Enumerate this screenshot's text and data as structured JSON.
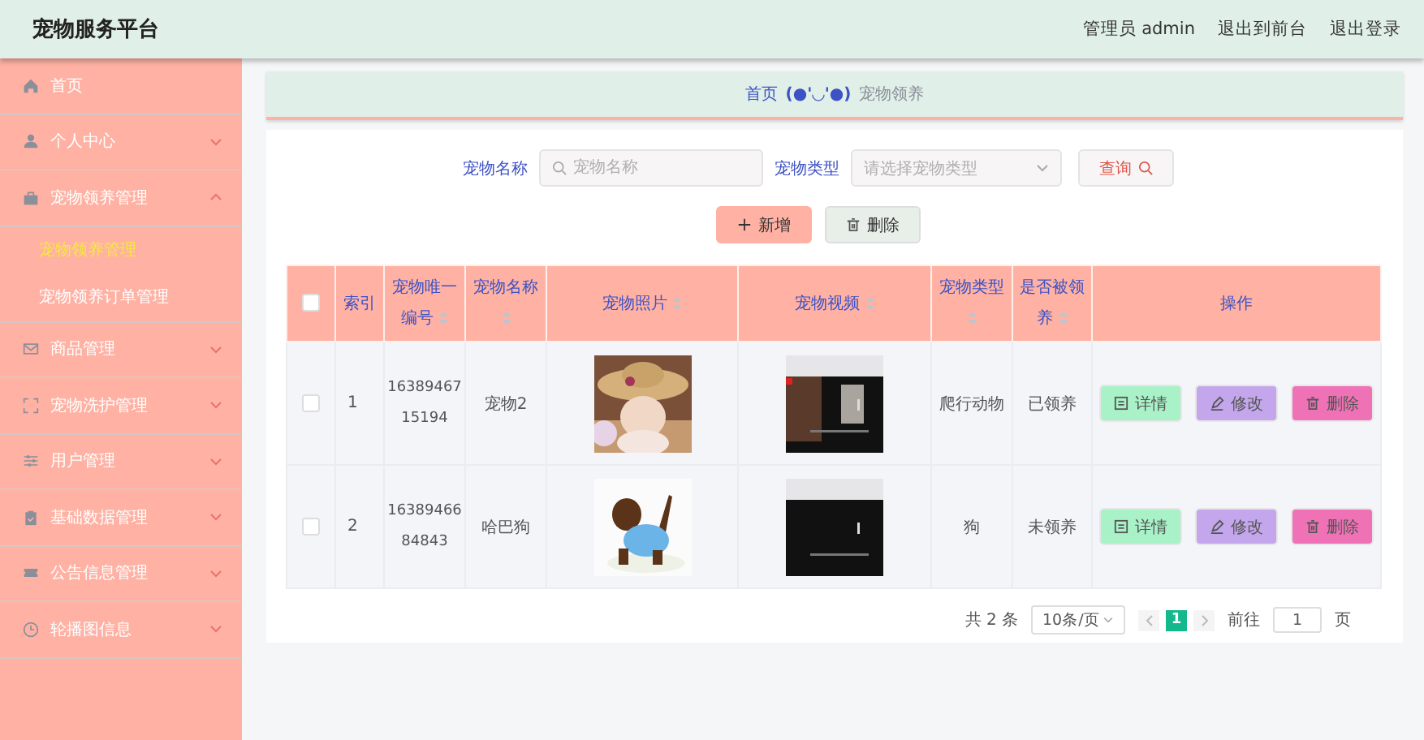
{
  "header": {
    "title": "宠物服务平台",
    "links": [
      "管理员 admin",
      "退出到前台",
      "退出登录"
    ]
  },
  "sidebar": {
    "items": [
      {
        "label": "首页"
      },
      {
        "label": "个人中心",
        "expanded": false
      },
      {
        "label": "宠物领养管理",
        "expanded": true,
        "children": [
          {
            "label": "宠物领养管理",
            "selected": true
          },
          {
            "label": "宠物领养订单管理",
            "selected": false
          }
        ]
      },
      {
        "label": "商品管理",
        "expanded": false
      },
      {
        "label": "宠物洗护管理",
        "expanded": false
      },
      {
        "label": "用户管理",
        "expanded": false
      },
      {
        "label": "基础数据管理",
        "expanded": false
      },
      {
        "label": "公告信息管理",
        "expanded": false
      },
      {
        "label": "轮播图信息",
        "expanded": false
      }
    ]
  },
  "breadcrumb": {
    "home": "首页",
    "separator": "(●'◡'●)",
    "current": "宠物领养"
  },
  "search": {
    "name_label": "宠物名称",
    "name_placeholder": "宠物名称",
    "type_label": "宠物类型",
    "type_placeholder": "请选择宠物类型",
    "button": "查询"
  },
  "toolbar": [
    {
      "kind": "add",
      "label": "新增"
    },
    {
      "kind": "delete",
      "label": "删除"
    }
  ],
  "table": {
    "all_checked": false,
    "columns": [
      {
        "label": "索引",
        "sortable": false
      },
      {
        "label": "宠物唯一编号",
        "sortable": true
      },
      {
        "label": "宠物名称",
        "sortable": true
      },
      {
        "label": "宠物照片",
        "sortable": true
      },
      {
        "label": "宠物视频",
        "sortable": true
      },
      {
        "label": "宠物类型",
        "sortable": true
      },
      {
        "label": "是否被领养",
        "sortable": true
      },
      {
        "label": "操作",
        "sortable": false
      }
    ],
    "rows": [
      {
        "checked": false,
        "index": "1",
        "id": "1638946715194",
        "name": "宠物2",
        "type": "爬行动物",
        "adopted": "已领养",
        "actions": [
          {
            "kind": "detail",
            "label": "详情"
          },
          {
            "kind": "edit",
            "label": "修改"
          },
          {
            "kind": "delete",
            "label": "删除"
          }
        ]
      },
      {
        "checked": false,
        "index": "2",
        "id": "1638946684843",
        "name": "哈巴狗",
        "type": "狗",
        "adopted": "未领养",
        "actions": [
          {
            "kind": "detail",
            "label": "详情"
          },
          {
            "kind": "edit",
            "label": "修改"
          },
          {
            "kind": "delete",
            "label": "删除"
          }
        ]
      }
    ]
  },
  "pagination": {
    "total": "共 2 条",
    "page_size": "10条/页",
    "pages": [
      {
        "label": "1",
        "selected": true
      }
    ],
    "goto_label": "前往",
    "goto_value": "1",
    "page_suffix": "页"
  }
}
